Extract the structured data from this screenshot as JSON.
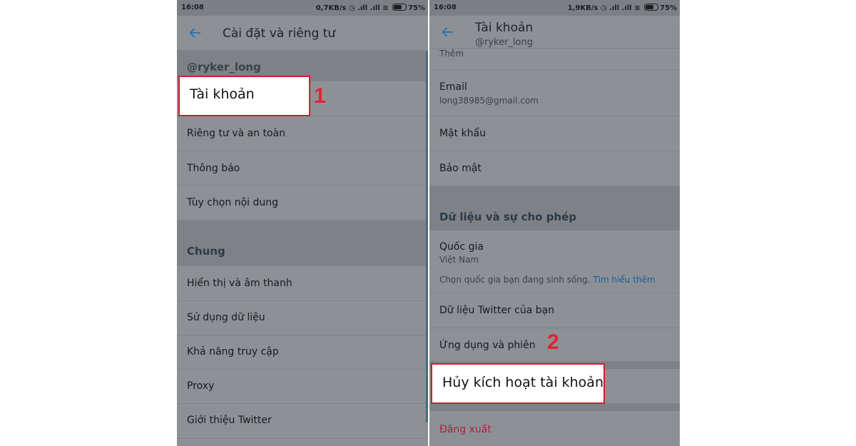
{
  "left": {
    "status": {
      "time": "16:08",
      "right": "0,7KB/s ◷ .ıll .ıll ≋",
      "battery": "75%"
    },
    "title": "Cài đặt và riêng tư",
    "username": "@ryker_long",
    "highlight_item": "Tài khoản",
    "marker": "1",
    "items": [
      "Riêng tư và an toàn",
      "Thông báo",
      "Tùy chọn nội dung"
    ],
    "section_general": "Chung",
    "general_items": [
      "Hiển thị và âm thanh",
      "Sử dụng dữ liệu",
      "Khả năng truy cập",
      "Proxy",
      "Giới thiệu Twitter"
    ]
  },
  "right": {
    "status": {
      "time": "16:08",
      "right": "1,9KB/s ◷ .ıll .ıll ≋",
      "battery": "75%"
    },
    "title": "Tài khoản",
    "subtitle": "@ryker_long",
    "partial_top": "Thêm",
    "email_label": "Email",
    "email_value": "long38985@gmail.com",
    "password": "Mật khẩu",
    "security": "Bảo mật",
    "section_data": "Dữ liệu và sự cho phép",
    "country_label": "Quốc gia",
    "country_value": "Việt Nam",
    "country_hint": "Chọn quốc gia bạn đang sinh sống.",
    "country_link": "Tìm hiểu thêm",
    "twitter_data": "Dữ liệu Twitter của bạn",
    "apps_sessions": "Ứng dụng và phiên",
    "marker": "2",
    "deactivate": "Hủy kích hoạt tài khoản",
    "logout": "Đăng xuất"
  },
  "colors": {
    "highlight": "#d01f2e",
    "marker": "#e52231",
    "dim_overlay": "#8d9196"
  }
}
